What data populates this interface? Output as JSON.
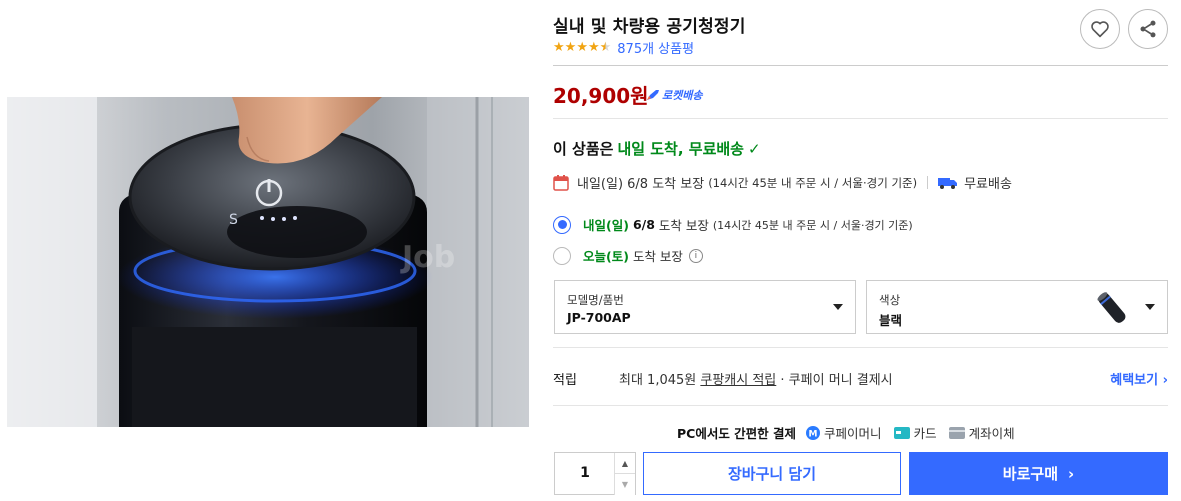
{
  "product": {
    "title": "실내 및 차량용 공기청정기",
    "rating_value": 4.5,
    "review_count": "875개 상품평",
    "price": "20,900원",
    "rocket_label": "로켓배송",
    "image_watermark": "Job"
  },
  "delivery": {
    "headline_prefix": "이 상품은",
    "headline_emphasis": "내일 도착, 무료배송",
    "arrival_main": "내일(일) 6/8 도착 보장",
    "arrival_detail": "(14시간 45분  내 주문 시 / 서울·경기 기준)",
    "free_shipping": "무료배송"
  },
  "options": [
    {
      "day": "내일(일)",
      "date": "6/8",
      "label": "도착 보장",
      "detail": "(14시간 45분 내 주문 시 / 서울·경기 기준)",
      "selected": true
    },
    {
      "day": "오늘(토)",
      "label": "도착 보장",
      "selected": false
    }
  ],
  "selects": {
    "model_label": "모델명/품번",
    "model_value": "JP-700AP",
    "color_label": "색상",
    "color_value": "블랙"
  },
  "points": {
    "label": "적립",
    "text_prefix": "최대 1,045원",
    "text_link": "쿠팡캐시 적립",
    "text_suffix": "· 쿠페이 머니 결제시",
    "benefit_link": "혜택보기"
  },
  "payment": {
    "title": "PC에서도 간편한 결제",
    "methods": [
      "쿠페이머니",
      "카드",
      "계좌이체"
    ]
  },
  "purchase": {
    "quantity": "1",
    "cart_label": "장바구니 담기",
    "buy_label": "바로구매"
  },
  "colors": {
    "accent": "#346aff",
    "price": "#ae0000",
    "green": "#00891a",
    "star": "#f1a412"
  }
}
